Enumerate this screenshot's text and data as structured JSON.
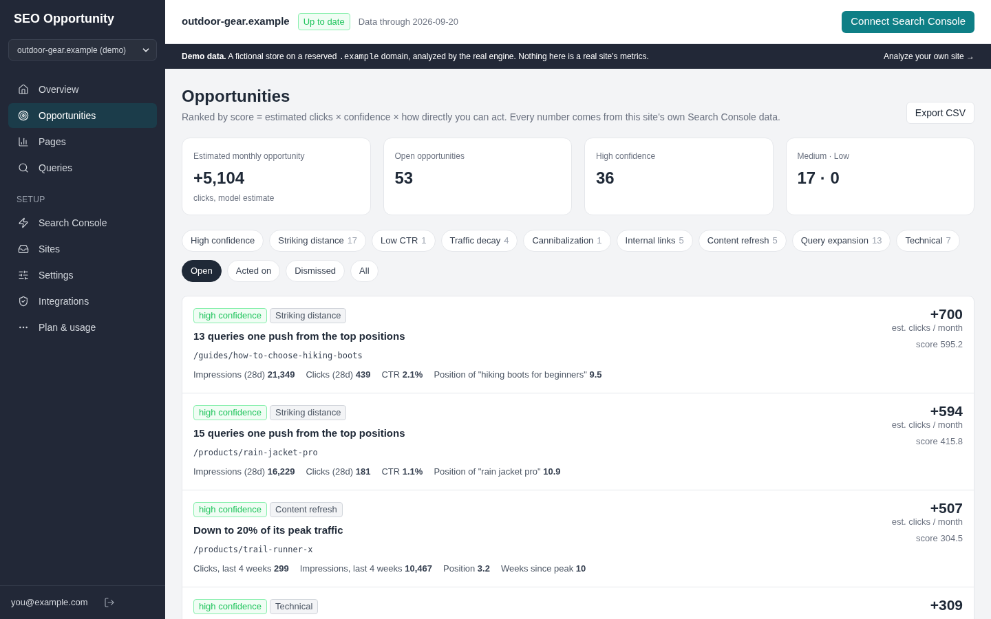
{
  "sidebar": {
    "title": "SEO Opportunity",
    "site_select": {
      "value": "outdoor-gear.example (demo)"
    },
    "nav_items": [
      {
        "label": "Overview",
        "selected": false
      },
      {
        "label": "Opportunities",
        "selected": true
      },
      {
        "label": "Pages",
        "selected": false
      },
      {
        "label": "Queries",
        "selected": false
      }
    ],
    "setup_heading": "SETUP",
    "setup_items": [
      {
        "label": "Search Console",
        "selected": false
      },
      {
        "label": "Sites",
        "selected": false
      },
      {
        "label": "Settings",
        "selected": false
      },
      {
        "label": "Integrations",
        "selected": false
      },
      {
        "label": "Plan & usage",
        "selected": false
      }
    ],
    "user_email": "you@example.com"
  },
  "top_bar": {
    "site": "outdoor-gear.example",
    "status": "Up to date",
    "data_through": "Data through 2026-09-20",
    "connect_button": "Connect Search Console"
  },
  "demo_banner": {
    "lead": "Demo data.",
    "before": "A fictional store on a reserved",
    "code": ".example",
    "after": "domain, analyzed by the real engine. Nothing here is a real site's metrics.",
    "link": "Analyze your own site →"
  },
  "header": {
    "title": "Opportunities",
    "subtitle": "Ranked by score = estimated clicks × confidence × how directly you can act. Every number comes from this site's own Search Console data.",
    "export_button": "Export CSV"
  },
  "stats": [
    {
      "label": "Estimated monthly opportunity",
      "value": "+5,104",
      "note": "clicks, model estimate"
    },
    {
      "label": "Open opportunities",
      "value": "53"
    },
    {
      "label": "High confidence",
      "value": "36"
    },
    {
      "label": "Medium · Low",
      "value": "17 · 0"
    }
  ],
  "type_filters": [
    {
      "label": "High confidence",
      "selected": false
    },
    {
      "label": "Striking distance",
      "count": "17",
      "selected": false
    },
    {
      "label": "Low CTR",
      "count": "1",
      "selected": false
    },
    {
      "label": "Traffic decay",
      "count": "4",
      "selected": false
    },
    {
      "label": "Cannibalization",
      "count": "1",
      "selected": false
    },
    {
      "label": "Internal links",
      "count": "5",
      "selected": false
    },
    {
      "label": "Content refresh",
      "count": "5",
      "selected": false
    },
    {
      "label": "Query expansion",
      "count": "13",
      "selected": false
    },
    {
      "label": "Technical",
      "count": "7",
      "selected": false
    }
  ],
  "status_tabs": [
    {
      "label": "Open",
      "selected": true
    },
    {
      "label": "Acted on",
      "selected": false
    },
    {
      "label": "Dismissed",
      "selected": false
    },
    {
      "label": "All",
      "selected": false
    }
  ],
  "opportunities": [
    {
      "confidence": {
        "label": "high confidence",
        "kind": "high"
      },
      "category": "Striking distance",
      "title": "13 queries one push from the top positions",
      "url": "/guides/how-to-choose-hiking-boots",
      "metrics": [
        {
          "label": "Impressions (28d)",
          "value": "21,349"
        },
        {
          "label": "Clicks (28d)",
          "value": "439"
        },
        {
          "label": "CTR",
          "value": "2.1%"
        },
        {
          "label": "Position of \"hiking boots for beginners\"",
          "value": "9.5"
        }
      ],
      "estimate": "+700",
      "estimate_unit": "est. clicks / month",
      "score": "score 595.2"
    },
    {
      "confidence": {
        "label": "high confidence",
        "kind": "high"
      },
      "category": "Striking distance",
      "title": "15 queries one push from the top positions",
      "url": "/products/rain-jacket-pro",
      "metrics": [
        {
          "label": "Impressions (28d)",
          "value": "16,229"
        },
        {
          "label": "Clicks (28d)",
          "value": "181"
        },
        {
          "label": "CTR",
          "value": "1.1%"
        },
        {
          "label": "Position of \"rain jacket pro\"",
          "value": "10.9"
        }
      ],
      "estimate": "+594",
      "estimate_unit": "est. clicks / month",
      "score": "score 415.8"
    },
    {
      "confidence": {
        "label": "high confidence",
        "kind": "high"
      },
      "category": "Content refresh",
      "title": "Down to 20% of its peak traffic",
      "url": "/products/trail-runner-x",
      "metrics": [
        {
          "label": "Clicks, last 4 weeks",
          "value": "299"
        },
        {
          "label": "Impressions, last 4 weeks",
          "value": "10,467"
        },
        {
          "label": "Position",
          "value": "3.2"
        },
        {
          "label": "Weeks since peak",
          "value": "10"
        }
      ],
      "estimate": "+507",
      "estimate_unit": "est. clicks / month",
      "score": "score 304.5"
    },
    {
      "confidence": {
        "label": "high confidence",
        "kind": "high"
      },
      "category": "Technical",
      "estimate": "+309"
    }
  ]
}
